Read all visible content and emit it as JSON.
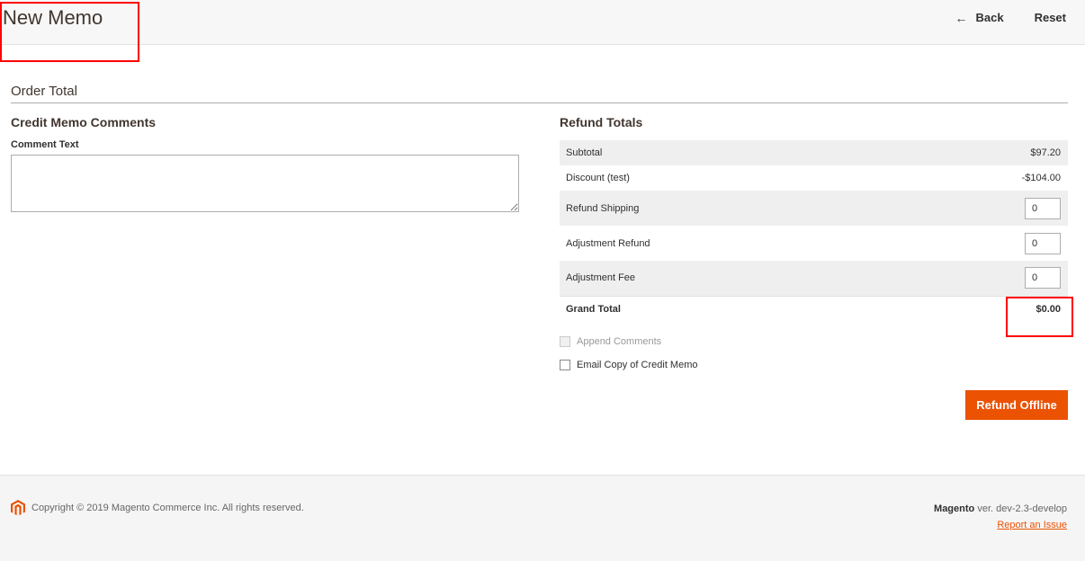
{
  "header": {
    "title": "New Memo",
    "back_label": "Back",
    "reset_label": "Reset",
    "back_icon": "arrow-left-icon"
  },
  "order_total": {
    "section_title": "Order Total"
  },
  "comments": {
    "title": "Credit Memo Comments",
    "comment_label": "Comment Text",
    "comment_value": ""
  },
  "refund_totals": {
    "title": "Refund Totals",
    "subtotal_label": "Subtotal",
    "subtotal_value": "$97.20",
    "discount_label": "Discount (test)",
    "discount_value": "-$104.00",
    "refund_shipping_label": "Refund Shipping",
    "refund_shipping_value": "0",
    "adjustment_refund_label": "Adjustment Refund",
    "adjustment_refund_value": "0",
    "adjustment_fee_label": "Adjustment Fee",
    "adjustment_fee_value": "0",
    "grand_total_label": "Grand Total",
    "grand_total_value": "$0.00",
    "append_comments_label": "Append Comments",
    "email_copy_label": "Email Copy of Credit Memo",
    "refund_button_label": "Refund Offline"
  },
  "footer": {
    "copyright": "Copyright © 2019 Magento Commerce Inc. All rights reserved.",
    "brand": "Magento",
    "version": " ver. dev-2.3-develop",
    "report_link": "Report an Issue",
    "logo_icon": "magento-logo-icon"
  },
  "colors": {
    "accent": "#eb5202",
    "highlight": "#ff0000"
  }
}
